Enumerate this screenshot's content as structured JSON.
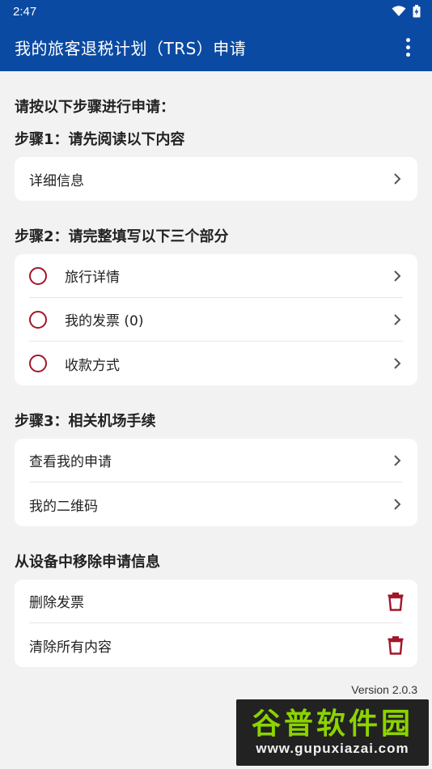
{
  "status_bar": {
    "time": "2:47"
  },
  "app_bar": {
    "title": "我的旅客退税计划（TRS）申请"
  },
  "intro": "请按以下步骤进行申请：",
  "step1": {
    "title": "步骤1：请先阅读以下内容",
    "items": [
      {
        "label": "详细信息"
      }
    ]
  },
  "step2": {
    "title": "步骤2：请完整填写以下三个部分",
    "items": [
      {
        "label": "旅行详情"
      },
      {
        "label": "我的发票 (0)"
      },
      {
        "label": "收款方式"
      }
    ]
  },
  "step3": {
    "title": "步骤3：相关机场手续",
    "items": [
      {
        "label": "查看我的申请"
      },
      {
        "label": "我的二维码"
      }
    ]
  },
  "remove": {
    "title": "从设备中移除申请信息",
    "items": [
      {
        "label": "删除发票"
      },
      {
        "label": "清除所有内容"
      }
    ]
  },
  "version": "Version 2.0.3",
  "watermark": {
    "main": "谷普软件园",
    "url": "www.gupuxiazai.com"
  },
  "colors": {
    "primary": "#0b4aa2",
    "accent": "#a3162a",
    "background": "#f2f2f2"
  },
  "icons": {
    "wifi": "wifi-icon",
    "battery": "battery-icon",
    "more": "more-vert-icon",
    "chevron": "chevron-right-icon",
    "radio": "radio-unchecked-icon",
    "trash": "trash-icon"
  }
}
